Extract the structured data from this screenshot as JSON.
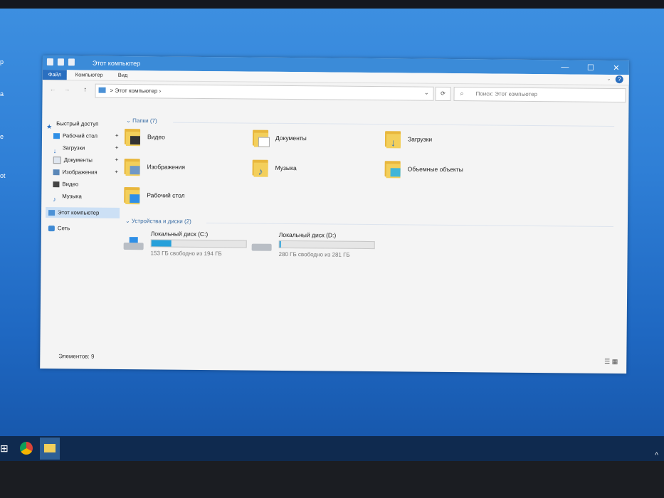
{
  "window": {
    "title": "Этот компьютер",
    "controls": {
      "minimize": "—",
      "maximize": "☐",
      "close": "✕"
    }
  },
  "ribbon": {
    "tabs": [
      "Файл",
      "Компьютер",
      "Вид"
    ]
  },
  "navigation": {
    "back": "←",
    "forward": "→",
    "up": "↑",
    "address_sep": ">",
    "address": "Этот компьютер",
    "address_chevron": "›",
    "refresh": "⟳",
    "search_placeholder": "Поиск: Этот компьютер"
  },
  "sidebar": {
    "quick_access": "Быстрый доступ",
    "pinned": [
      {
        "label": "Рабочий стол",
        "pinned": true
      },
      {
        "label": "Загрузки",
        "pinned": true
      },
      {
        "label": "Документы",
        "pinned": true
      },
      {
        "label": "Изображения",
        "pinned": true
      },
      {
        "label": "Видео",
        "pinned": false
      },
      {
        "label": "Музыка",
        "pinned": false
      }
    ],
    "this_pc": "Этот компьютер",
    "network": "Сеть"
  },
  "content": {
    "folders_group": "Папки (7)",
    "folders": [
      "Видео",
      "Документы",
      "Загрузки",
      "Изображения",
      "Музыка",
      "Объемные объекты",
      "Рабочий стол"
    ],
    "devices_group": "Устройства и диски (2)",
    "drives": [
      {
        "name": "Локальный диск (C:)",
        "free": "153 ГБ свободно из 194 ГБ",
        "used_fraction": 0.21
      },
      {
        "name": "Локальный диск (D:)",
        "free": "280 ГБ свободно из 281 ГБ",
        "used_fraction": 0.01
      }
    ]
  },
  "status": {
    "items": "Элементов: 9"
  },
  "colors": {
    "accent": "#2a6fc0",
    "titlebar": "#3b8bd8",
    "folder": "#f3cf5b",
    "drive_bar": "#26a0da"
  }
}
